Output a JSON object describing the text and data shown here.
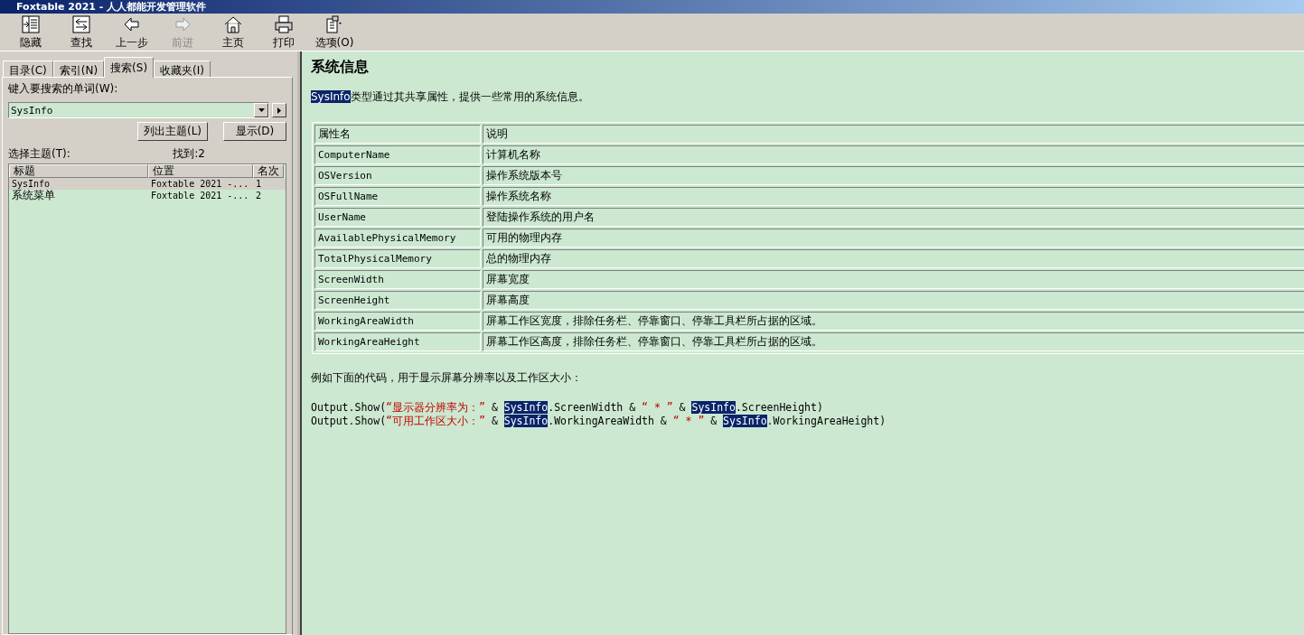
{
  "window": {
    "title": "Foxtable 2021 - 人人都能开发管理软件"
  },
  "toolbar": [
    {
      "label": "隐藏",
      "kind": "hide",
      "disabled": false
    },
    {
      "label": "查找",
      "kind": "find",
      "disabled": false
    },
    {
      "label": "上一步",
      "kind": "back",
      "disabled": false
    },
    {
      "label": "前进",
      "kind": "forward",
      "disabled": true
    },
    {
      "label": "主页",
      "kind": "home",
      "disabled": false
    },
    {
      "label": "打印",
      "kind": "print",
      "disabled": false
    },
    {
      "label": "选项(O)",
      "kind": "options",
      "disabled": false
    }
  ],
  "tabs": [
    {
      "label": "目录(C)",
      "selected": false
    },
    {
      "label": "索引(N)",
      "selected": false
    },
    {
      "label": "搜索(S)",
      "selected": true
    },
    {
      "label": "收藏夹(I)",
      "selected": false
    }
  ],
  "search": {
    "label": "键入要搜索的单词(W):",
    "value": "SysInfo",
    "list_button": "列出主题(L)",
    "display_button": "显示(D)"
  },
  "results": {
    "label": "选择主题(T):",
    "found": "找到:2",
    "columns": [
      "标题",
      "位置",
      "名次"
    ],
    "rows": [
      {
        "cells": [
          "SysInfo",
          "Foxtable 2021 -...",
          "1"
        ],
        "selected": true
      },
      {
        "cells": [
          "系统菜单",
          "Foxtable 2021 -...",
          "2"
        ],
        "selected": false
      }
    ]
  },
  "topic": {
    "heading": "系统信息",
    "intro": [
      {
        "kind": "highlight",
        "text": "SysInfo"
      },
      {
        "kind": "plain",
        "text": "类型通过其共享属性，提供一些常用的系统信息。"
      }
    ],
    "table": {
      "columns": [
        "属性名",
        "说明"
      ],
      "rows": [
        [
          "ComputerName",
          "计算机名称"
        ],
        [
          "OSVersion",
          "操作系统版本号"
        ],
        [
          "OSFullName",
          "操作系统名称"
        ],
        [
          "UserName",
          "登陆操作系统的用户名"
        ],
        [
          "AvailablePhysicalMemory",
          "可用的物理内存"
        ],
        [
          "TotalPhysicalMemory",
          "总的物理内存"
        ],
        [
          "ScreenWidth",
          "屏幕宽度"
        ],
        [
          "ScreenHeight",
          "屏幕高度"
        ],
        [
          "WorkingAreaWidth",
          "屏幕工作区宽度，排除任务栏、停靠窗口、停靠工具栏所占据的区域。"
        ],
        [
          "WorkingAreaHeight",
          "屏幕工作区高度，排除任务栏、停靠窗口、停靠工具栏所占据的区域。"
        ]
      ]
    },
    "example_text": "例如下面的代码，用于显示屏幕分辨率以及工作区大小：",
    "code": [
      [
        {
          "kind": "plain",
          "text": "Output.Show("
        },
        {
          "kind": "string",
          "text": "“显示器分辨率为：”"
        },
        {
          "kind": "plain",
          "text": " & "
        },
        {
          "kind": "highlight",
          "text": "SysInfo"
        },
        {
          "kind": "plain",
          "text": ".ScreenWidth & "
        },
        {
          "kind": "string",
          "text": "“ * ”"
        },
        {
          "kind": "plain",
          "text": " & "
        },
        {
          "kind": "highlight",
          "text": "SysInfo"
        },
        {
          "kind": "plain",
          "text": ".ScreenHeight)"
        }
      ],
      [
        {
          "kind": "plain",
          "text": "Output.Show("
        },
        {
          "kind": "string",
          "text": "“可用工作区大小：”"
        },
        {
          "kind": "plain",
          "text": " & "
        },
        {
          "kind": "highlight",
          "text": "SysInfo"
        },
        {
          "kind": "plain",
          "text": ".WorkingAreaWidth & "
        },
        {
          "kind": "string",
          "text": "“ * ”"
        },
        {
          "kind": "plain",
          "text": " & "
        },
        {
          "kind": "highlight",
          "text": "SysInfo"
        },
        {
          "kind": "plain",
          "text": ".WorkingAreaHeight)"
        }
      ]
    ]
  }
}
